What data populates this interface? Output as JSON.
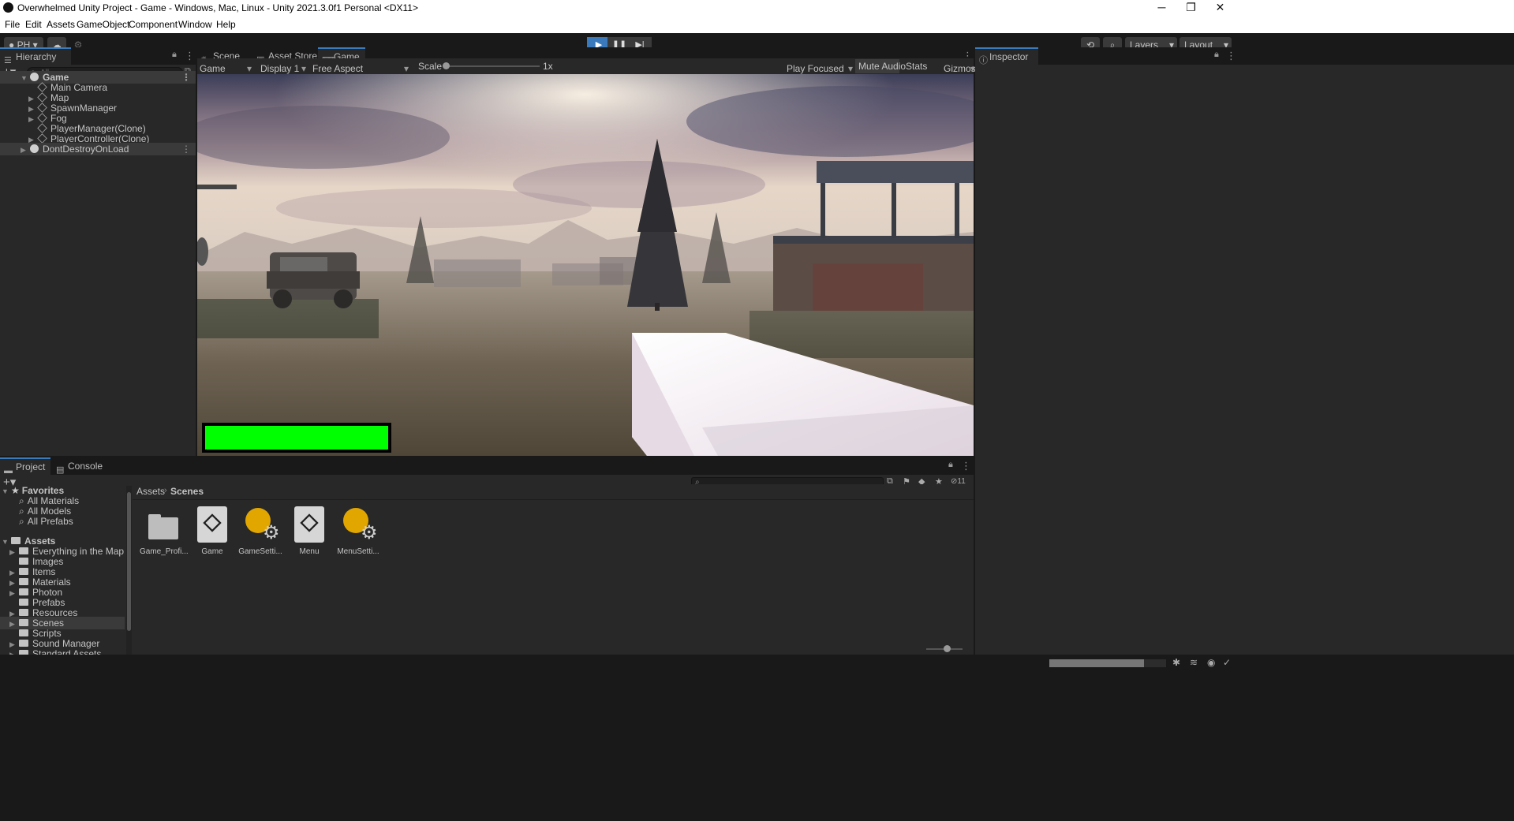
{
  "window": {
    "title": "Overwhelmed Unity Project - Game - Windows, Mac, Linux - Unity 2021.3.0f1 Personal <DX11>",
    "controls": [
      "─",
      "❐",
      "✕"
    ]
  },
  "menu": [
    "File",
    "Edit",
    "Assets",
    "GameObject",
    "Component",
    "Window",
    "Help"
  ],
  "toolbar": {
    "account": "PH",
    "layers": "Layers",
    "layout": "Layout"
  },
  "hierarchy": {
    "tab": "Hierarchy",
    "search_placeholder": "All",
    "items": [
      {
        "label": "Game",
        "depth": 0,
        "expanded": true,
        "selected": true
      },
      {
        "label": "Main Camera",
        "depth": 1
      },
      {
        "label": "Map",
        "depth": 1,
        "collapsed": true
      },
      {
        "label": "SpawnManager",
        "depth": 1,
        "collapsed": true
      },
      {
        "label": "Fog",
        "depth": 1,
        "collapsed": true
      },
      {
        "label": "PlayerManager(Clone)",
        "depth": 1
      },
      {
        "label": "PlayerController(Clone)",
        "depth": 1,
        "collapsed": true
      },
      {
        "label": "DontDestroyOnLoad",
        "depth": 0,
        "collapsed": true,
        "selected": true
      }
    ]
  },
  "center_tabs": [
    "Scene",
    "Asset Store",
    "Game"
  ],
  "game_controls": {
    "view": "Game",
    "display": "Display 1",
    "aspect": "Free Aspect",
    "scale_label": "Scale",
    "scale_value": "1x",
    "play_focused": "Play Focused",
    "mute_audio": "Mute Audio",
    "stats": "Stats",
    "gizmos": "Gizmos"
  },
  "hud": {
    "health_fraction": 1.0,
    "health_color": "#00ff00"
  },
  "inspector": {
    "tab": "Inspector"
  },
  "bottom_tabs": [
    "Project",
    "Console"
  ],
  "project": {
    "hidden_count": "11",
    "favorites_label": "Favorites",
    "favorites": [
      "All Materials",
      "All Models",
      "All Prefabs"
    ],
    "assets_label": "Assets",
    "folders": [
      "Everything in the Map",
      "Images",
      "Items",
      "Materials",
      "Photon",
      "Prefabs",
      "Resources",
      "Scenes",
      "Scripts",
      "Sound Manager",
      "Standard Assets"
    ],
    "selected_folder": "Scenes",
    "breadcrumb": [
      "Assets",
      "Scenes"
    ],
    "assets": [
      {
        "label": "Game_Profi...",
        "icon": "folder-icon"
      },
      {
        "label": "Game",
        "icon": "unity-scene-icon"
      },
      {
        "label": "GameSetti...",
        "icon": "lighting-settings-icon"
      },
      {
        "label": "Menu",
        "icon": "unity-scene-icon"
      },
      {
        "label": "MenuSetti...",
        "icon": "lighting-settings-icon"
      }
    ]
  },
  "colors": {
    "accent": "#3a79bb",
    "play_active": "#3a79bb",
    "panel": "#282828",
    "settings_yellow": "#e2a600"
  }
}
